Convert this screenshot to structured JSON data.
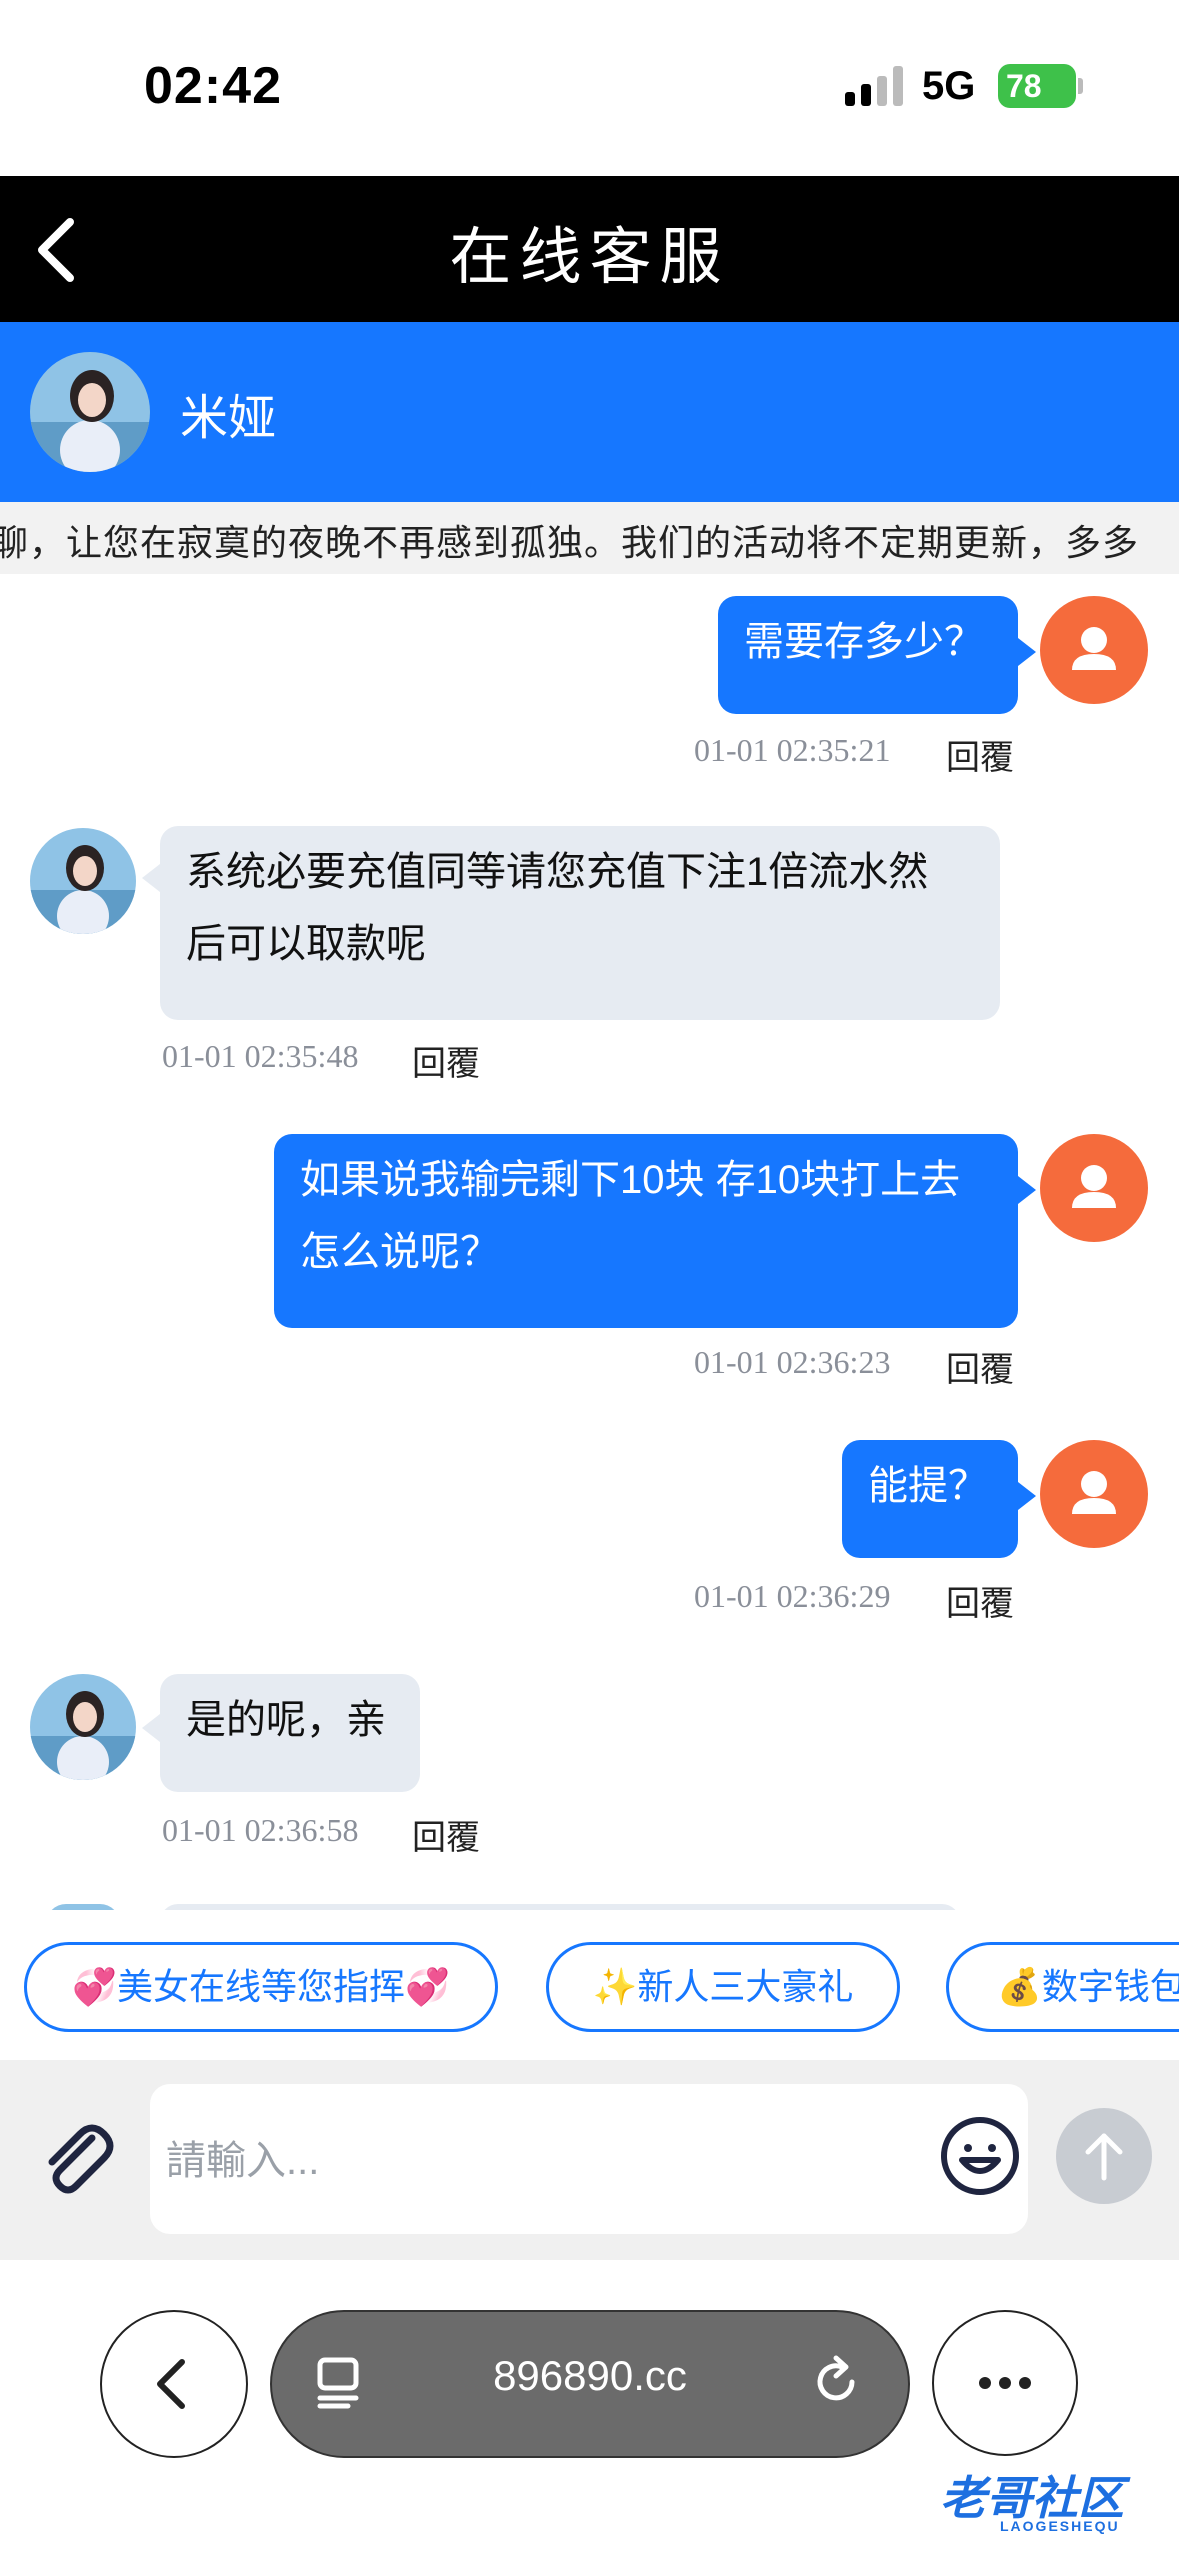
{
  "status_bar": {
    "time": "02:42",
    "network": "5G",
    "battery": "78"
  },
  "header": {
    "title": "在线客服"
  },
  "agent": {
    "name": "米娅"
  },
  "marquee": {
    "text": "聊，让您在寂寞的夜晚不再感到孤独。我们的活动将不定期更新，多多"
  },
  "messages": [
    {
      "direction": "out",
      "text": "需要存多少？",
      "time": "01-01 02:35:21",
      "reply": "回覆"
    },
    {
      "direction": "in",
      "line1": "系统必要充值同等请您充值下注1倍流水然",
      "line2": "后可以取款呢",
      "time": "01-01 02:35:48",
      "reply": "回覆"
    },
    {
      "direction": "out",
      "line1": "如果说我输完剩下10块 存10块打上去",
      "line2": "怎么说呢？",
      "time": "01-01 02:36:23",
      "reply": "回覆"
    },
    {
      "direction": "out",
      "text": "能提？",
      "time": "01-01 02:36:29",
      "reply": "回覆"
    },
    {
      "direction": "in",
      "text": "是的呢，亲",
      "time": "01-01 02:36:58",
      "reply": "回覆"
    }
  ],
  "quick_replies": [
    "💞美女在线等您指挥💞",
    "✨新人三大豪礼",
    "💰数字钱包"
  ],
  "input": {
    "placeholder": "請輸入..."
  },
  "browser": {
    "url": "896890.cc"
  },
  "watermark": {
    "text": "老哥社区",
    "sub": "LAOGESHEQU"
  },
  "colors": {
    "accent": "#1677ff",
    "user_avatar": "#f56b3c",
    "incoming_bubble": "#e6ebf2"
  },
  "icons": [
    "back-chevron-icon",
    "attachment-icon",
    "emoji-icon",
    "send-arrow-icon",
    "tabs-icon",
    "reload-icon",
    "more-icon",
    "user-icon"
  ]
}
